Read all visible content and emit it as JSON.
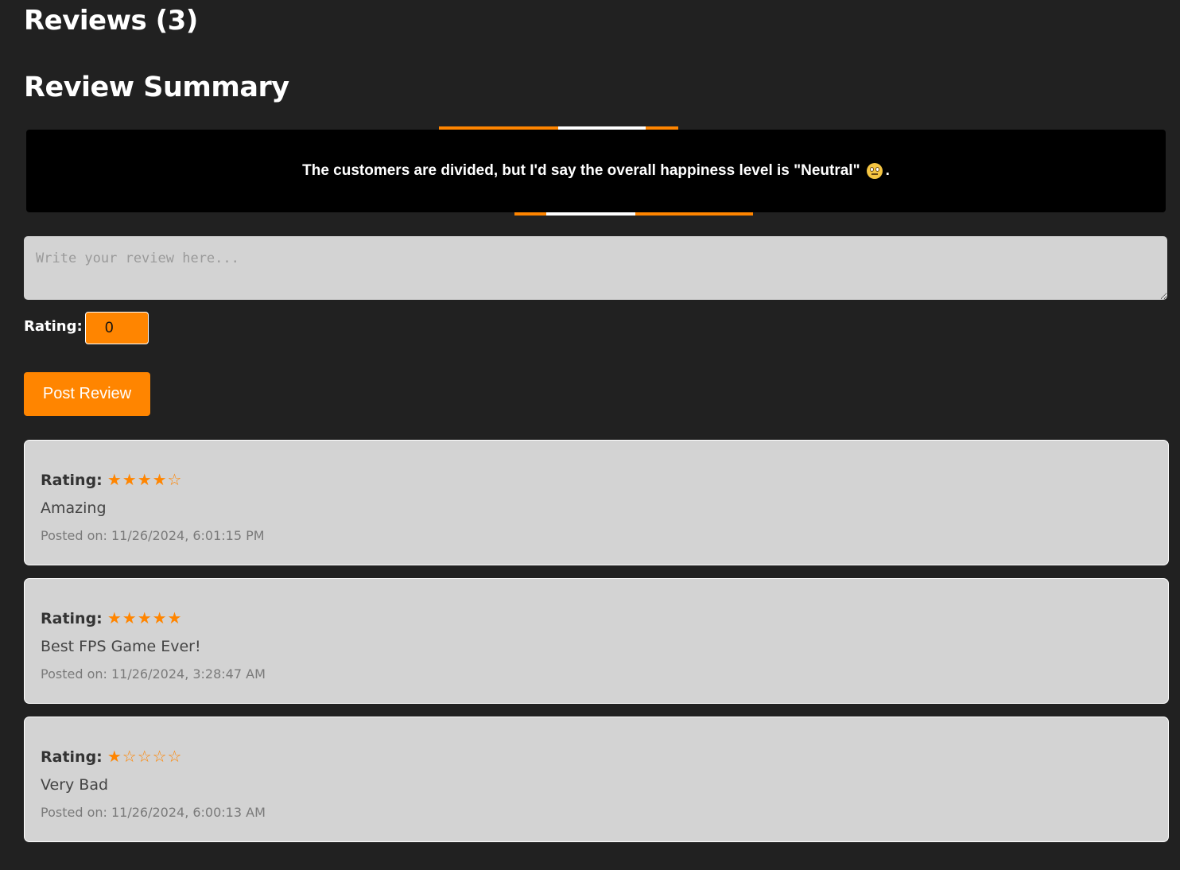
{
  "header": {
    "title": "Reviews (3)",
    "summary_title": "Review Summary"
  },
  "summary": {
    "text": "The customers are divided, but I'd say the overall happiness level is \"Neutral\"",
    "emoji": "neutral-face",
    "trailing": "."
  },
  "form": {
    "placeholder": "Write your review here...",
    "rating_label": "Rating:",
    "rating_value": "0",
    "post_label": "Post Review"
  },
  "colors": {
    "background": "#212121",
    "accent": "#ff8500",
    "banner": "#000000",
    "card": "#d3d3d3"
  },
  "reviews": [
    {
      "rating_label": "Rating:",
      "stars": "★★★★☆",
      "rating": 4,
      "text": "Amazing",
      "date": "Posted on: 11/26/2024, 6:01:15 PM"
    },
    {
      "rating_label": "Rating:",
      "stars": "★★★★★",
      "rating": 5,
      "text": "Best FPS Game Ever!",
      "date": "Posted on: 11/26/2024, 3:28:47 AM"
    },
    {
      "rating_label": "Rating:",
      "stars": "★☆☆☆☆",
      "rating": 1,
      "text": "Very Bad",
      "date": "Posted on: 11/26/2024, 6:00:13 AM"
    }
  ]
}
